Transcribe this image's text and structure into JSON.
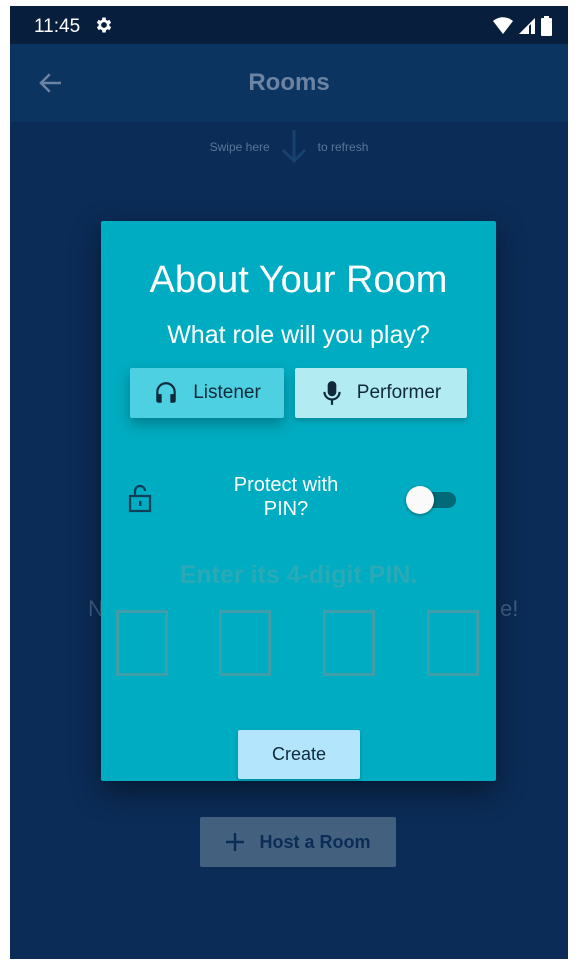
{
  "status_bar": {
    "time": "11:45",
    "icons": [
      "gear-icon",
      "wifi-icon",
      "signal-icon",
      "battery-icon"
    ]
  },
  "app_bar": {
    "title": "Rooms",
    "back_icon": "arrow-left-icon"
  },
  "background": {
    "refresh_hint_before": "Swipe here",
    "refresh_hint_after": "to refresh",
    "text_left_fragment": "N",
    "text_right_fragment": "e!",
    "host_button_label": "Host a Room"
  },
  "dialog": {
    "title": "About Your Room",
    "subtitle": "What role will you play?",
    "roles": [
      {
        "label": "Listener",
        "icon": "headphones-icon",
        "selected": true
      },
      {
        "label": "Performer",
        "icon": "microphone-icon",
        "selected": false
      }
    ],
    "pin_toggle_label": "Protect with PIN?",
    "pin_toggle_on": false,
    "pin_instruction": "Enter its 4-digit PIN.",
    "pin_digits": [
      "",
      "",
      "",
      ""
    ],
    "create_label": "Create"
  },
  "colors": {
    "background": "#0b2c57",
    "app_bar": "#0b3461",
    "dialog": "#00acc1",
    "listener_button": "#4dd0e1",
    "performer_button": "#b2ebf2",
    "create_button": "#b3e5fc"
  }
}
